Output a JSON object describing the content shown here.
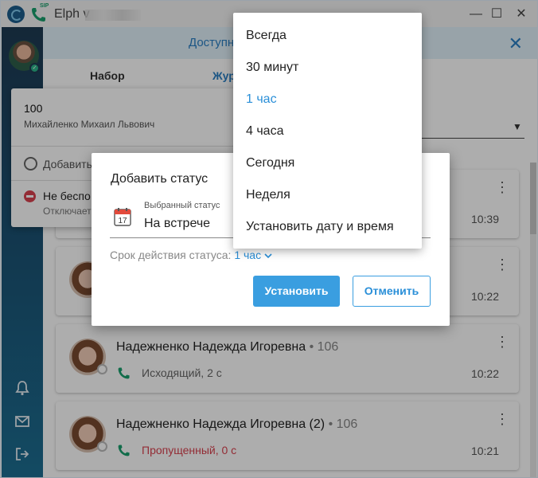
{
  "window": {
    "title": "Elph v",
    "sip_badge": "SIP",
    "minimize": "—",
    "maximize": "☐",
    "close": "✕"
  },
  "banner": {
    "text": "Доступн",
    "close": "✕"
  },
  "tabs": [
    {
      "label": "Набор"
    },
    {
      "label": "Жур"
    }
  ],
  "profile_popup": {
    "number": "100",
    "name": "Михайленко Михаил Львович",
    "add_status": "Добавить",
    "dnd_label": "Не беспо",
    "dnd_sub": "Отключает"
  },
  "modal": {
    "title": "Добавить статус",
    "field_label": "Выбранный статус",
    "field_value": "На встрече",
    "calendar_day": "17",
    "duration_label": "Срок действия статуса:",
    "duration_value": "1 час",
    "confirm": "Установить",
    "cancel": "Отменить"
  },
  "dropdown": {
    "items": [
      "Всегда",
      "30 минут",
      "1 час",
      "4 часа",
      "Сегодня",
      "Неделя",
      "Установить дату и время"
    ],
    "selected": "1 час"
  },
  "calls": [
    {
      "name": "",
      "ext": "",
      "type": "",
      "time": "10:39",
      "missed": false
    },
    {
      "name": "",
      "ext": "",
      "type": "",
      "time": "10:22",
      "missed": false
    },
    {
      "name": "Надежненко Надежда Игоревна",
      "ext": "• 106",
      "type": "Исходящий, 2 с",
      "time": "10:22",
      "missed": false
    },
    {
      "name": "Надежненко Надежда Игоревна (2)",
      "ext": "• 106",
      "type": "Пропущенный, 0 с",
      "time": "10:21",
      "missed": true
    }
  ],
  "colors": {
    "accent": "#3a9ee0",
    "missed": "#d9414e",
    "online": "#2bb48a",
    "sidebar_top": "#1e3a52",
    "sidebar_bottom": "#1c6e92"
  }
}
